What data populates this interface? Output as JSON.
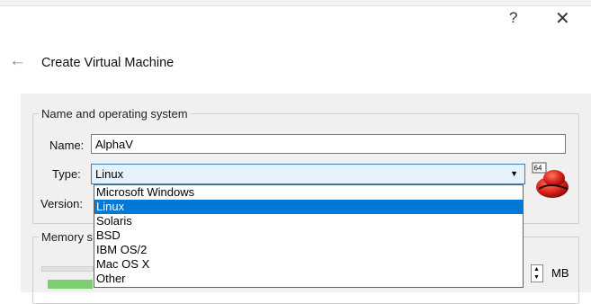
{
  "window": {
    "help_glyph": "?",
    "close_glyph": "✕"
  },
  "header": {
    "title": "Create Virtual Machine"
  },
  "name_os_group": {
    "legend": "Name and operating system",
    "name_label": "Name:",
    "name_value": "AlphaV",
    "type_label": "Type:",
    "type_value": "Linux",
    "version_label": "Version:",
    "os_icon": "linux-64-icon",
    "os_icon_badge": "64"
  },
  "type_dropdown": {
    "options": [
      "Microsoft Windows",
      "Linux",
      "Solaris",
      "BSD",
      "IBM OS/2",
      "Mac OS X",
      "Other"
    ],
    "selected": "Linux"
  },
  "memory_group": {
    "legend": "Memory s",
    "unit": "MB"
  },
  "colors": {
    "selection": "#0078d7",
    "combo_bg": "#e5f1fb",
    "combo_border": "#3c7fb1",
    "slider_ticks": "#7ccf6f"
  }
}
